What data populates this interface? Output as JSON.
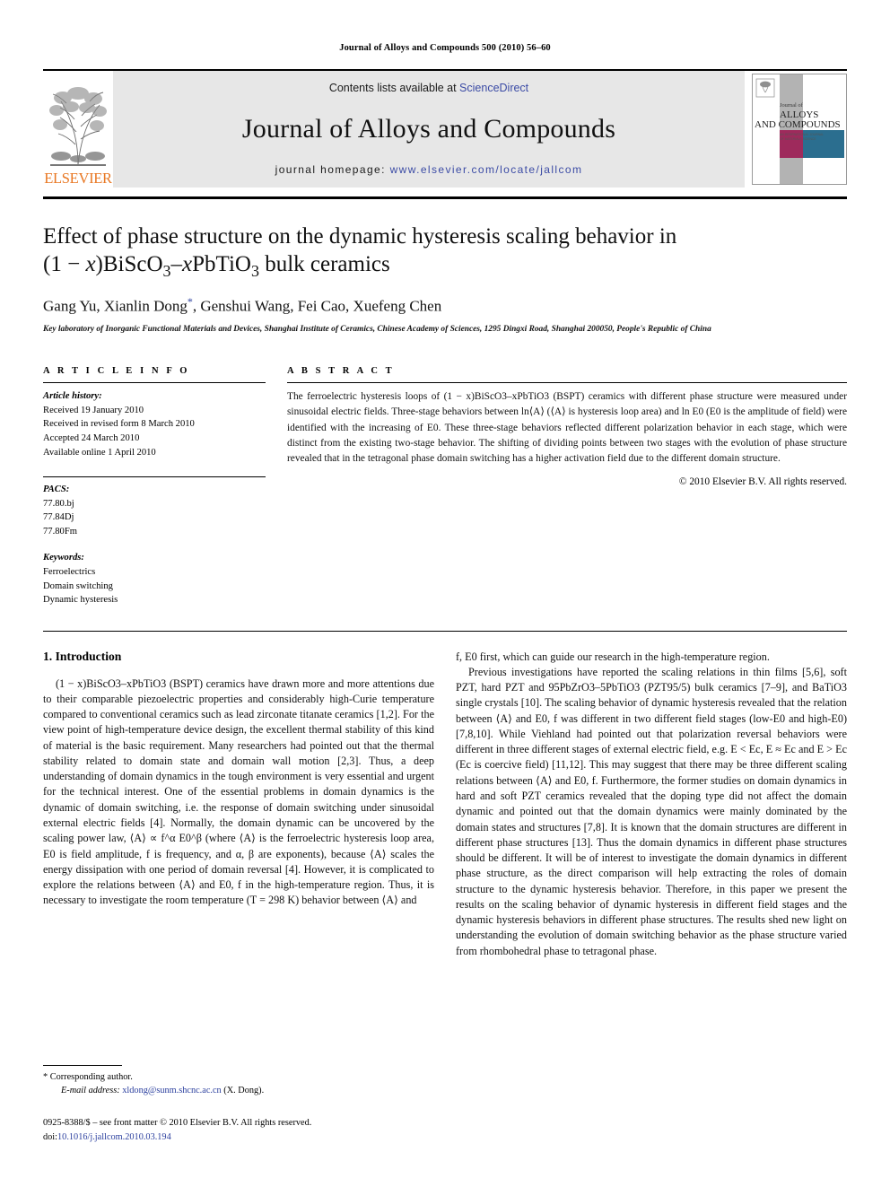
{
  "running_head": "Journal of Alloys and Compounds 500 (2010) 56–60",
  "masthead": {
    "publisher_word": "ELSEVIER",
    "contents_prefix": "Contents lists available at ",
    "sciencedirect": "ScienceDirect",
    "journal_title": "Journal of Alloys and Compounds",
    "homepage_prefix": "journal homepage: ",
    "homepage_url": "www.elsevier.com/locate/jallcom",
    "cover_line1": "Journal of",
    "cover_line2": "ALLOYS",
    "cover_line3": "AND COMPOUNDS",
    "accent_magenta": "#9e2a5c",
    "accent_teal": "#2b6e8f",
    "accent_grey": "#b3b3b3",
    "band_bg": "#e7e7e7",
    "link_blue": "#3b4ba5",
    "elsevier_orange": "#E87722"
  },
  "article": {
    "title_line1": "Effect of phase structure on the dynamic hysteresis scaling behavior in",
    "title_line2_pre": "(1 − ",
    "title_line2_x": "x",
    "title_line2_post": ")BiScO",
    "title_sub1": "3",
    "title_line2_mid": "–",
    "title_line2_x2": "x",
    "title_line2_post2": "PbTiO",
    "title_sub2": "3",
    "title_line2_tail": " bulk ceramics",
    "authors": "Gang Yu, Xianlin Dong",
    "authors_tail": ", Genshui Wang, Fei Cao, Xuefeng Chen",
    "corresponding_marker": "*",
    "affiliation": "Key laboratory of Inorganic Functional Materials and Devices, Shanghai Institute of Ceramics, Chinese Academy of Sciences, 1295 Dingxi Road, Shanghai 200050, People's Republic of China"
  },
  "article_info": {
    "heading": "A R T I C L E   I N F O",
    "history_label": "Article history:",
    "history": [
      "Received 19 January 2010",
      "Received in revised form 8 March 2010",
      "Accepted 24 March 2010",
      "Available online 1 April 2010"
    ],
    "pacs_label": "PACS:",
    "pacs": [
      "77.80.bj",
      "77.84Dj",
      "77.80Fm"
    ],
    "keywords_label": "Keywords:",
    "keywords": [
      "Ferroelectrics",
      "Domain switching",
      "Dynamic hysteresis"
    ]
  },
  "abstract": {
    "heading": "A B S T R A C T",
    "text": "The ferroelectric hysteresis loops of (1 − x)BiScO3–xPbTiO3 (BSPT) ceramics with different phase structure were measured under sinusoidal electric fields. Three-stage behaviors between ln⟨A⟩ (⟨A⟩ is hysteresis loop area) and ln E0 (E0 is the amplitude of field) were identified with the increasing of E0. These three-stage behaviors reflected different polarization behavior in each stage, which were distinct from the existing two-stage behavior. The shifting of dividing points between two stages with the evolution of phase structure revealed that in the tetragonal phase domain switching has a higher activation field due to the different domain structure.",
    "copyright": "© 2010 Elsevier B.V. All rights reserved."
  },
  "body": {
    "section_number_title": "1. Introduction",
    "left_paragraph_1": "(1 − x)BiScO3–xPbTiO3 (BSPT) ceramics have drawn more and more attentions due to their comparable piezoelectric properties and considerably high-Curie temperature compared to conventional ceramics such as lead zirconate titanate ceramics [1,2]. For the view point of high-temperature device design, the excellent thermal stability of this kind of material is the basic requirement. Many researchers had pointed out that the thermal stability related to domain state and domain wall motion [2,3]. Thus, a deep understanding of domain dynamics in the tough environment is very essential and urgent for the technical interest. One of the essential problems in domain dynamics is the dynamic of domain switching, i.e. the response of domain switching under sinusoidal external electric fields [4]. Normally, the domain dynamic can be uncovered by the scaling power law, ⟨A⟩ ∝ f^α E0^β (where ⟨A⟩ is the ferroelectric hysteresis loop area, E0 is field amplitude, f is frequency, and α, β are exponents), because ⟨A⟩ scales the energy dissipation with one period of domain reversal [4]. However, it is complicated to explore the relations between ⟨A⟩ and E0, f in the high-temperature region. Thus, it is necessary to investigate the room temperature (T = 298 K) behavior between ⟨A⟩ and",
    "right_paragraph_1_cont": "f, E0 first, which can guide our research in the high-temperature region.",
    "right_paragraph_2": "Previous investigations have reported the scaling relations in thin films [5,6], soft PZT, hard PZT and 95PbZrO3–5PbTiO3 (PZT95/5) bulk ceramics [7–9], and BaTiO3 single crystals [10]. The scaling behavior of dynamic hysteresis revealed that the relation between ⟨A⟩ and E0, f was different in two different field stages (low-E0 and high-E0) [7,8,10]. While Viehland had pointed out that polarization reversal behaviors were different in three different stages of external electric field, e.g. E < Ec, E ≈ Ec and E > Ec (Ec is coercive field) [11,12]. This may suggest that there may be three different scaling relations between ⟨A⟩ and E0, f. Furthermore, the former studies on domain dynamics in hard and soft PZT ceramics revealed that the doping type did not affect the domain dynamic and pointed out that the domain dynamics were mainly dominated by the domain states and structures [7,8]. It is known that the domain structures are different in different phase structures [13]. Thus the domain dynamics in different phase structures should be different. It will be of interest to investigate the domain dynamics in different phase structure, as the direct comparison will help extracting the roles of domain structure to the dynamic hysteresis behavior. Therefore, in this paper we present the results on the scaling behavior of dynamic hysteresis in different field stages and the dynamic hysteresis behaviors in different phase structures. The results shed new light on understanding the evolution of domain switching behavior as the phase structure varied from rhombohedral phase to tetragonal phase."
  },
  "footnote": {
    "corresponding_marker": "*",
    "corresponding_label": "Corresponding author.",
    "email_label": "E-mail address:",
    "email": "xldong@sunm.shcnc.ac.cn",
    "email_owner": "(X. Dong).",
    "issn_line": "0925-8388/$ – see front matter © 2010 Elsevier B.V. All rights reserved.",
    "doi_label": "doi:",
    "doi_value": "10.1016/j.jallcom.2010.03.194"
  }
}
